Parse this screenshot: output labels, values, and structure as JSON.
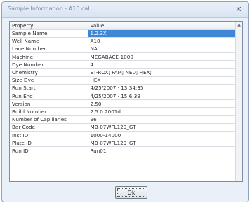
{
  "window": {
    "title": "Sample Information - A10.cal",
    "close_label": "✕"
  },
  "grid": {
    "headers": [
      "Property",
      "Value"
    ],
    "rows": [
      {
        "property": "Sample Name",
        "value": "1.2.3X"
      },
      {
        "property": "Well Name",
        "value": "A10"
      },
      {
        "property": "Lane Number",
        "value": "NA"
      },
      {
        "property": "Machine",
        "value": "MEGABACE-1000"
      },
      {
        "property": "Dye Number",
        "value": "4"
      },
      {
        "property": "Chemistry",
        "value": "ET-ROX;  FAM;  NED;  HEX;"
      },
      {
        "property": "Size Dye",
        "value": "HEX"
      },
      {
        "property": "Run Start",
        "value": "4/25/2007 · 13:34:35"
      },
      {
        "property": "Run End",
        "value": "4/25/2007 · 15:6:39"
      },
      {
        "property": "Version",
        "value": "2.50"
      },
      {
        "property": "Build Number",
        "value": "2.5.0.2001d"
      },
      {
        "property": "Number of Capillaries",
        "value": "96"
      },
      {
        "property": "Bar Code",
        "value": "MB-07WFL129_GT"
      },
      {
        "property": "Inst ID",
        "value": "1000-14000"
      },
      {
        "property": "Plate ID",
        "value": "MB-07WFL129_GT"
      },
      {
        "property": "Run ID",
        "value": "Run01"
      }
    ]
  },
  "ok_label": "Ok"
}
